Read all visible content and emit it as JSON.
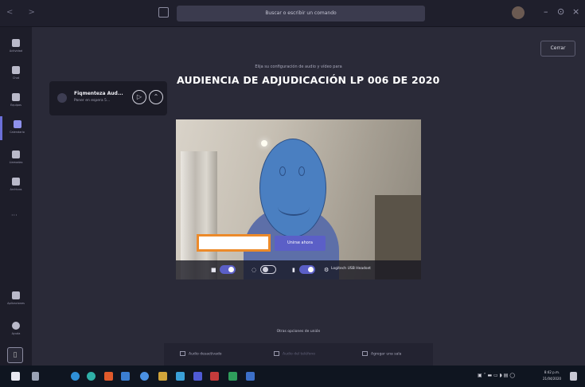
{
  "window": {
    "search_placeholder": "Buscar o escribir un comando",
    "minimize": "–",
    "restore": "⊙",
    "close": "×"
  },
  "sidebar": {
    "items": [
      {
        "label": "Actividad"
      },
      {
        "label": "Chat"
      },
      {
        "label": "Equipos"
      },
      {
        "label": "Calendario"
      },
      {
        "label": "Llamadas"
      },
      {
        "label": "Archivos"
      }
    ],
    "more": "···",
    "bottom": [
      {
        "label": "Aplicaciones"
      },
      {
        "label": "Ayuda"
      }
    ]
  },
  "pre_join": {
    "close_label": "Cerrar",
    "call_pill": {
      "name": "Fiqmenteza Aud...",
      "sub": "Poner en espera  5...",
      "expand": "⊖"
    },
    "subtitle": "Elija su configuración de audio y vídeo para",
    "meeting_title": "AUDIENCIA DE ADJUDICACIÓN LP 006 DE 2020",
    "name_input": {
      "value": "",
      "placeholder": ""
    },
    "join_label": "Unirse ahora",
    "device_label": "Logitech USB Headset",
    "camera_on": true,
    "blur_on": false,
    "mic_on": true,
    "other_options_label": "Otras opciones de unión",
    "options": [
      {
        "label": "Audio desactivado"
      },
      {
        "label": "Audio del teléfono"
      },
      {
        "label": "Agregar una sala"
      }
    ]
  },
  "tray": {
    "time": "8:42 p.m.",
    "date": "21/04/2020"
  },
  "colors": {
    "accent": "#5b5fc7",
    "background": "#2a2a38",
    "input_border": "#ec8a2a",
    "face": "#4a7fc1"
  }
}
